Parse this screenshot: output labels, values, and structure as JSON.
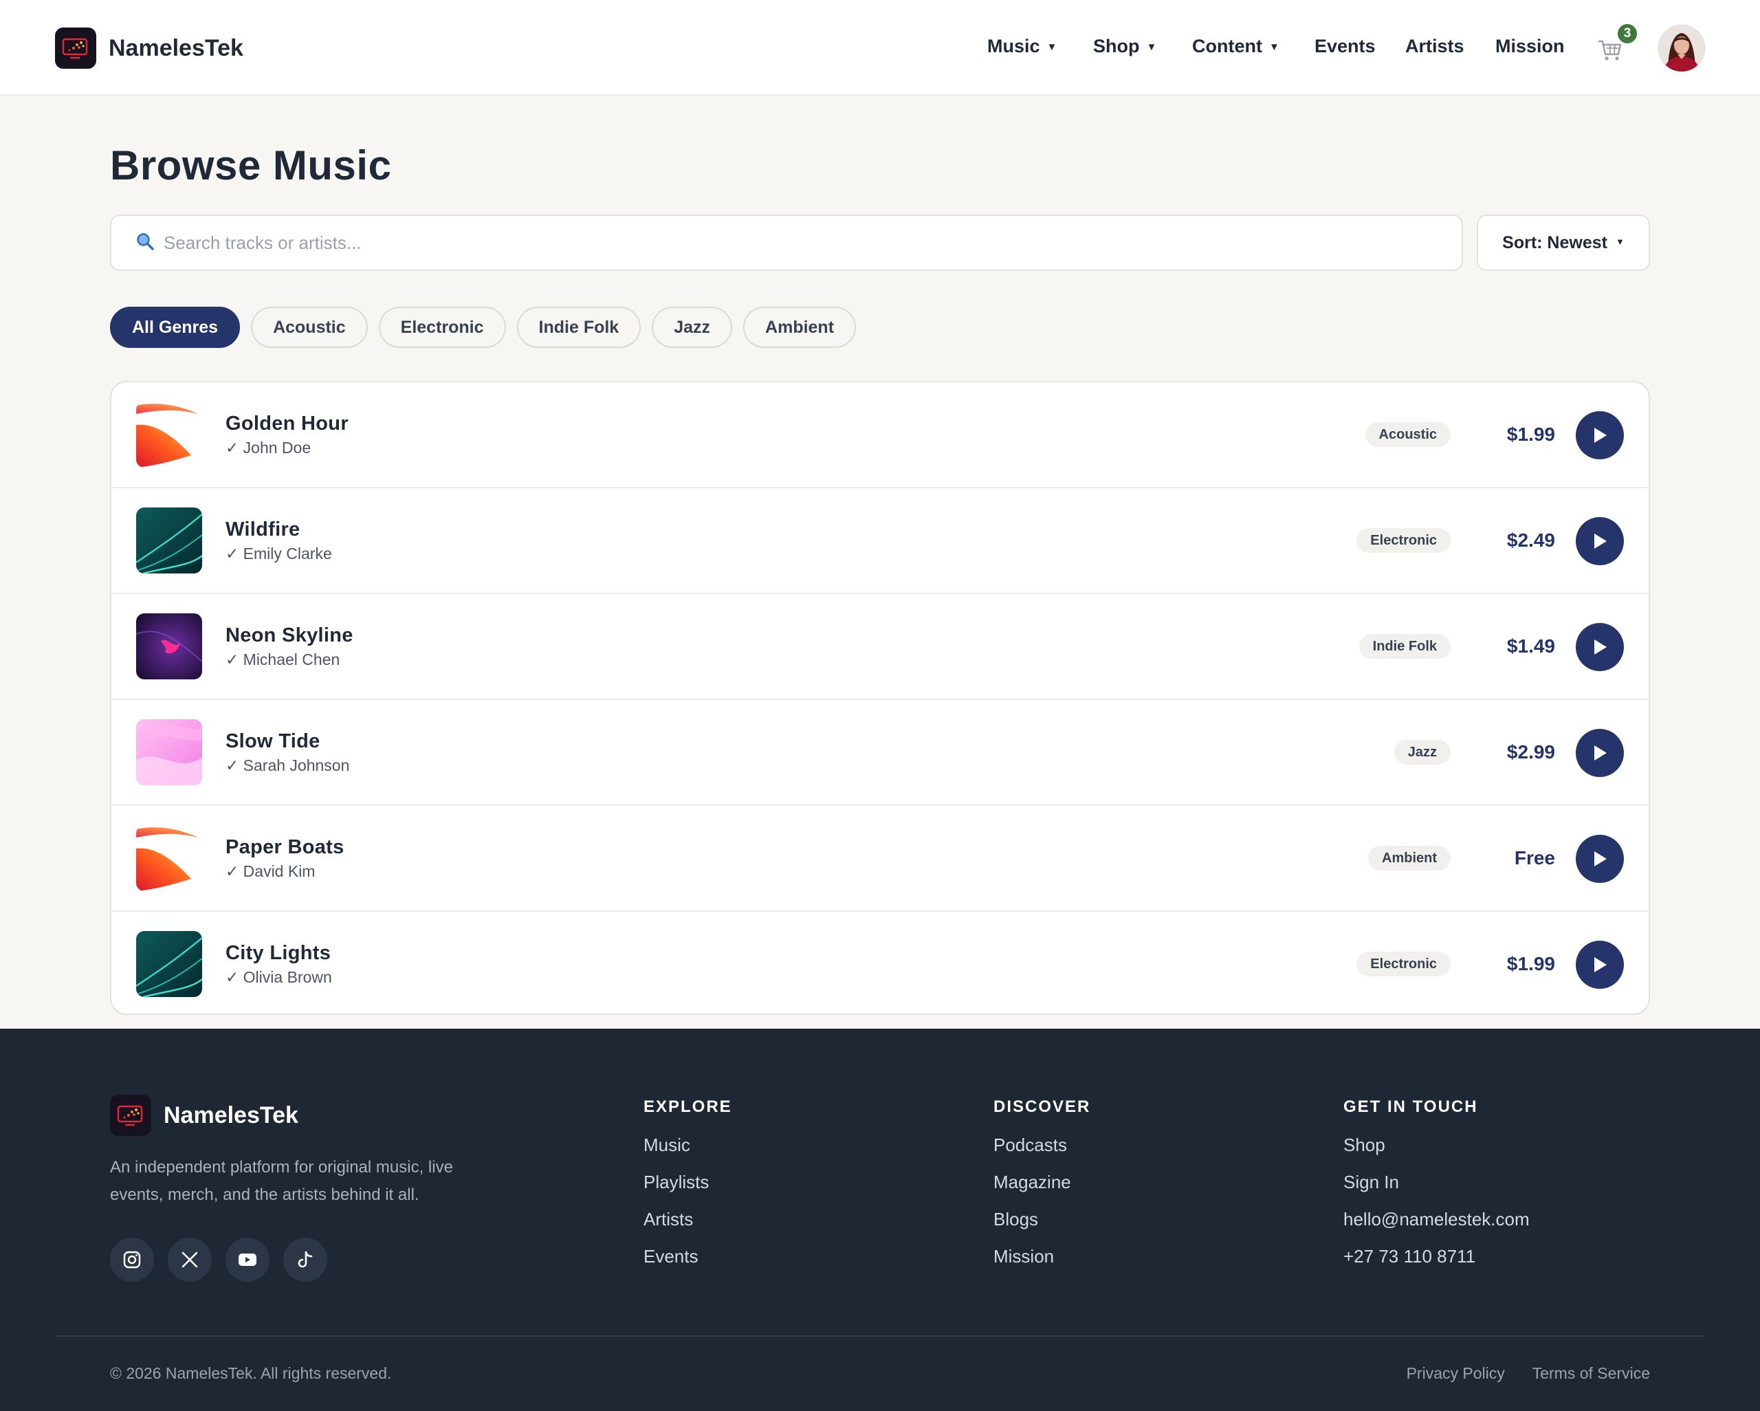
{
  "header": {
    "brand": "NamelesTek",
    "nav": [
      {
        "label": "Music",
        "dropdown": true
      },
      {
        "label": "Shop",
        "dropdown": true
      },
      {
        "label": "Content",
        "dropdown": true
      },
      {
        "label": "Events",
        "dropdown": false
      },
      {
        "label": "Artists",
        "dropdown": false
      },
      {
        "label": "Mission",
        "dropdown": false
      }
    ],
    "cart_count": "3",
    "cart_icon": "cart-icon",
    "avatar_icon": "user-avatar"
  },
  "main": {
    "title": "Browse Music",
    "search_placeholder": "Search tracks or artists...",
    "search_value": "",
    "search_icon": "search-icon",
    "sort_label": "Sort: Newest",
    "genres": [
      "All Genres",
      "Acoustic",
      "Electronic",
      "Indie Folk",
      "Jazz",
      "Ambient"
    ],
    "active_genre": "All Genres",
    "tracks": [
      {
        "title": "Golden Hour",
        "artist": "✓ John Doe",
        "genre": "Acoustic",
        "price": "$1.99",
        "art": "warm-flame"
      },
      {
        "title": "Wildfire",
        "artist": "✓ Emily Clarke",
        "genre": "Electronic",
        "price": "$2.49",
        "art": "teal-waves"
      },
      {
        "title": "Neon Skyline",
        "artist": "✓ Michael Chen",
        "genre": "Indie Folk",
        "price": "$1.49",
        "art": "purple-neon"
      },
      {
        "title": "Slow Tide",
        "artist": "✓ Sarah Johnson",
        "genre": "Jazz",
        "price": "$2.99",
        "art": "pink-tide"
      },
      {
        "title": "Paper Boats",
        "artist": "✓ David Kim",
        "genre": "Ambient",
        "price": "Free",
        "art": "warm-flame"
      },
      {
        "title": "City Lights",
        "artist": "✓ Olivia Brown",
        "genre": "Electronic",
        "price": "$1.99",
        "art": "teal-waves"
      }
    ]
  },
  "footer": {
    "brand": "NamelesTek",
    "description": "An independent platform for original music, live events, merch, and the artists behind it all.",
    "socials": [
      "instagram-icon",
      "x-icon",
      "youtube-icon",
      "tiktok-icon"
    ],
    "columns": [
      {
        "heading": "EXPLORE",
        "links": [
          "Music",
          "Playlists",
          "Artists",
          "Events"
        ]
      },
      {
        "heading": "DISCOVER",
        "links": [
          "Podcasts",
          "Magazine",
          "Blogs",
          "Mission"
        ]
      },
      {
        "heading": "GET IN TOUCH",
        "links": [
          "Shop",
          "Sign In",
          "hello@namelestek.com",
          "+27 73 110 8711"
        ]
      }
    ],
    "copyright": "© 2026 NamelesTek. All rights reserved.",
    "legal": [
      "Privacy Policy",
      "Terms of Service"
    ]
  },
  "colors": {
    "accent": "#25346b",
    "background": "#f7f6f2",
    "footer_bg": "#1f2735",
    "badge": "#3f7a3c"
  }
}
